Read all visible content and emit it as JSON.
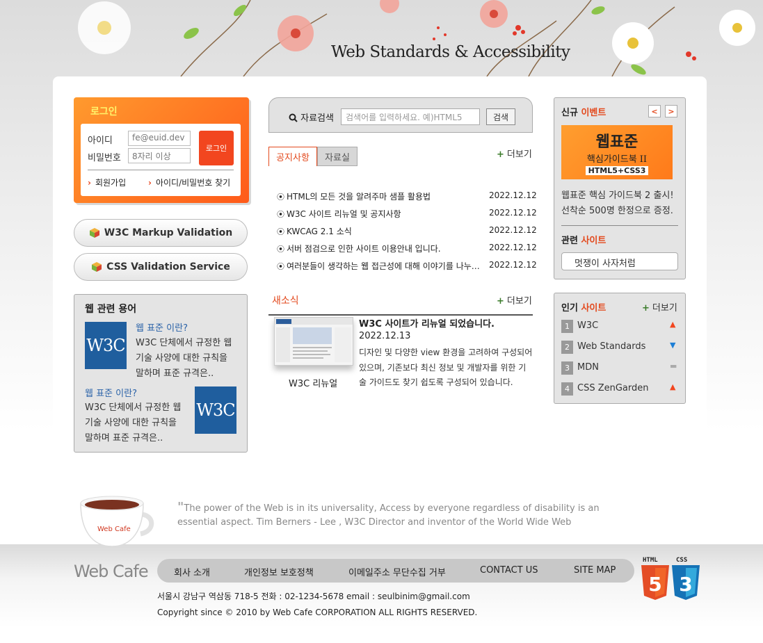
{
  "header": {
    "title": "Web Standards & Accessibility"
  },
  "login": {
    "title": "로그인",
    "id_label": "아이디",
    "id_value": "fe@euid.dev",
    "pw_label": "비밀번호",
    "pw_placeholder": "8자리 이상",
    "button": "로그인",
    "join_link": "회원가입",
    "find_link": "아이디/비밀번호 찾기"
  },
  "validation": {
    "markup": "W3C Markup Validation",
    "css": "CSS Validation Service"
  },
  "terms": {
    "title": "웹 관련 용어",
    "items": [
      {
        "head": "웹 표준 이란?",
        "lines": [
          "W3C 단체에서 규정한 웹",
          "기술 사양에 대한 규칙을",
          "말하며 표준 규격은.."
        ],
        "logo": "W3C"
      },
      {
        "head": "웹 표준 이란?",
        "lines": [
          "W3C 단체에서 규정한 웹",
          "기술 사양에 대한 규칙을",
          "말하며 표준 규격은.."
        ],
        "logo": "W3C"
      }
    ]
  },
  "search": {
    "label": "자료검색",
    "placeholder": "검색어를 입력하세요. 예)HTML5",
    "button": "검색"
  },
  "tabs": {
    "notice": "공지사항",
    "data": "자료실",
    "more": "더보기"
  },
  "notices": [
    {
      "title": "HTML의 모든 것을 알려주마 샘플 활용법",
      "date": "2022.12.12"
    },
    {
      "title": "W3C 사이트 리뉴얼 및 공지사항",
      "date": "2022.12.12"
    },
    {
      "title": "KWCAG 2.1 소식",
      "date": "2022.12.12"
    },
    {
      "title": "서버 점검으로 인한 사이트 이용안내 입니다.",
      "date": "2022.12.12"
    },
    {
      "title": "여러분들이 생각하는 웹 접근성에 대해 이야기를 나누어 봅시다",
      "date": "2022.12.12"
    }
  ],
  "news": {
    "title": "새소식",
    "more": "더보기",
    "caption": "W3C 리뉴얼",
    "headline": "W3C 사이트가 리뉴얼 되었습니다.",
    "date": "2022.12.13",
    "body": "디자인 및 다양한 view 환경을 고려하여 구성되어 있으며, 기존보다 최신 정보 및 개발자를 위한 기술 가이드도 찾기 쉽도록 구성되어 있습니다."
  },
  "event": {
    "title_a": "신규",
    "title_b": "이벤트",
    "prev": "<",
    "next": ">",
    "book_title": "웹표준",
    "book_subtitle": "핵심가이드북 II",
    "book_tag": "HTML5+CSS3",
    "line1": "웹표준 핵심 가이드북 2 출시!",
    "line2": "선착순 500명 한정으로 증정."
  },
  "related": {
    "title_a": "관련",
    "title_b": "사이트",
    "selected": "멋쟁이 사자처럼"
  },
  "popular": {
    "title_a": "인기",
    "title_b": "사이트",
    "more": "더보기",
    "items": [
      {
        "rank": "1",
        "name": "W3C",
        "trend": "up",
        "color": "#f2461f"
      },
      {
        "rank": "2",
        "name": "Web Standards",
        "trend": "down",
        "color": "#1d7fd6"
      },
      {
        "rank": "3",
        "name": "MDN",
        "trend": "same",
        "color": "#aaaaaa"
      },
      {
        "rank": "4",
        "name": "CSS ZenGarden",
        "trend": "up",
        "color": "#f2461f"
      }
    ]
  },
  "quote": {
    "mark": "\"",
    "text": "The power of the Web is in its universality, Access by everyone regardless of disability is an essential aspect. Tim Berners - Lee , W3C Director and inventor of the World Wide Web"
  },
  "footer": {
    "brand": "Web Cafe",
    "cup_label": "Web Cafe",
    "links": [
      "회사 소개",
      "개인정보 보호정책",
      "이메일주소 무단수집 거부",
      "CONTACT US",
      "SITE MAP"
    ],
    "address": "서울시 강남구 역삼동 718-5 전화 : 02-1234-5678 email : seulbinim@gmail.com",
    "copyright": "Copyright since © 2010 by Web Cafe CORPORATION ALL RIGHTS RESERVED.",
    "html_badge": "HTML",
    "html_num": "5",
    "css_badge": "CSS",
    "css_num": "3"
  },
  "colors": {
    "accent": "#e3491d",
    "login_orange": "#ff6a1f",
    "link_blue": "#2a62a8"
  }
}
